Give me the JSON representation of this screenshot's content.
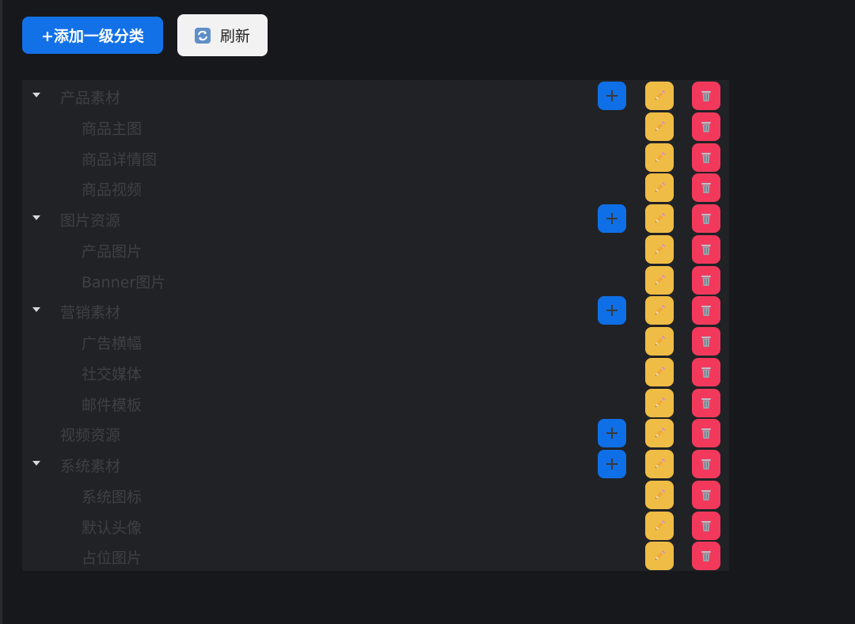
{
  "toolbar": {
    "add_root_label": "+添加一级分类",
    "refresh_label": "刷新"
  },
  "icons": {
    "add": "plus-icon",
    "edit": "pencil-icon",
    "delete": "trash-icon",
    "refresh": "refresh-icon",
    "caret": "caret-down-icon"
  },
  "colors": {
    "add": "#0f6fe6",
    "edit": "#efbd45",
    "delete": "#f2395c",
    "primary_button": "#1371e8"
  },
  "tree": {
    "rows": [
      {
        "label": "产品素材",
        "level": 1,
        "expandable": true,
        "can_add": true
      },
      {
        "label": "商品主图",
        "level": 2,
        "expandable": false,
        "can_add": false
      },
      {
        "label": "商品详情图",
        "level": 2,
        "expandable": false,
        "can_add": false
      },
      {
        "label": "商品视频",
        "level": 2,
        "expandable": false,
        "can_add": false
      },
      {
        "label": "图片资源",
        "level": 1,
        "expandable": true,
        "can_add": true
      },
      {
        "label": "产品图片",
        "level": 2,
        "expandable": false,
        "can_add": false
      },
      {
        "label": "Banner图片",
        "level": 2,
        "expandable": false,
        "can_add": false
      },
      {
        "label": "营销素材",
        "level": 1,
        "expandable": true,
        "can_add": true
      },
      {
        "label": "广告横幅",
        "level": 2,
        "expandable": false,
        "can_add": false
      },
      {
        "label": "社交媒体",
        "level": 2,
        "expandable": false,
        "can_add": false
      },
      {
        "label": "邮件模板",
        "level": 2,
        "expandable": false,
        "can_add": false
      },
      {
        "label": "视频资源",
        "level": 1,
        "expandable": false,
        "can_add": true
      },
      {
        "label": "系统素材",
        "level": 1,
        "expandable": true,
        "can_add": true
      },
      {
        "label": "系统图标",
        "level": 2,
        "expandable": false,
        "can_add": false
      },
      {
        "label": "默认头像",
        "level": 2,
        "expandable": false,
        "can_add": false
      },
      {
        "label": "占位图片",
        "level": 2,
        "expandable": false,
        "can_add": false
      }
    ]
  }
}
